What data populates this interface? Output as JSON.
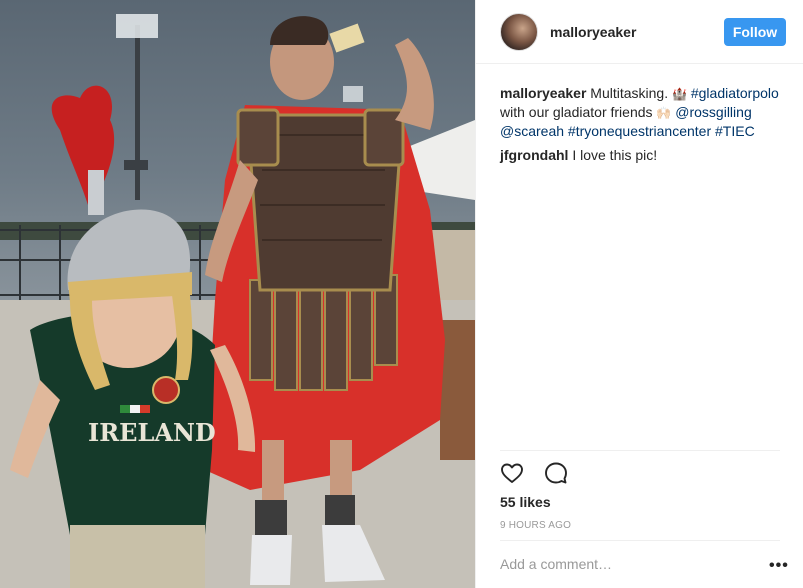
{
  "header": {
    "username": "malloryeaker",
    "follow_label": "Follow"
  },
  "caption": {
    "username": "malloryeaker",
    "text_1": "Multitasking. ",
    "emoji_1": "🏰",
    "hashtag_1": "#gladiatorpolo",
    "text_2": " with our gladiator friends ",
    "emoji_2": "🙌🏻",
    "mention_1": "@rossgilling",
    "mention_2": "@scareah",
    "hashtag_2": "#tryonequestriancenter",
    "hashtag_3": "#TIEC"
  },
  "comments": [
    {
      "username": "jfgrondahl",
      "text": "I love this pic!"
    }
  ],
  "likes": "55 likes",
  "timestamp": "9 HOURS AGO",
  "add_comment_placeholder": "Add a comment…",
  "more_label": "•••",
  "photo_text": "IRELAND",
  "colors": {
    "accent": "#3897f0",
    "link": "#003569",
    "muted": "#999999"
  },
  "icons": [
    "heart-icon",
    "comment-icon",
    "more-options-icon"
  ]
}
